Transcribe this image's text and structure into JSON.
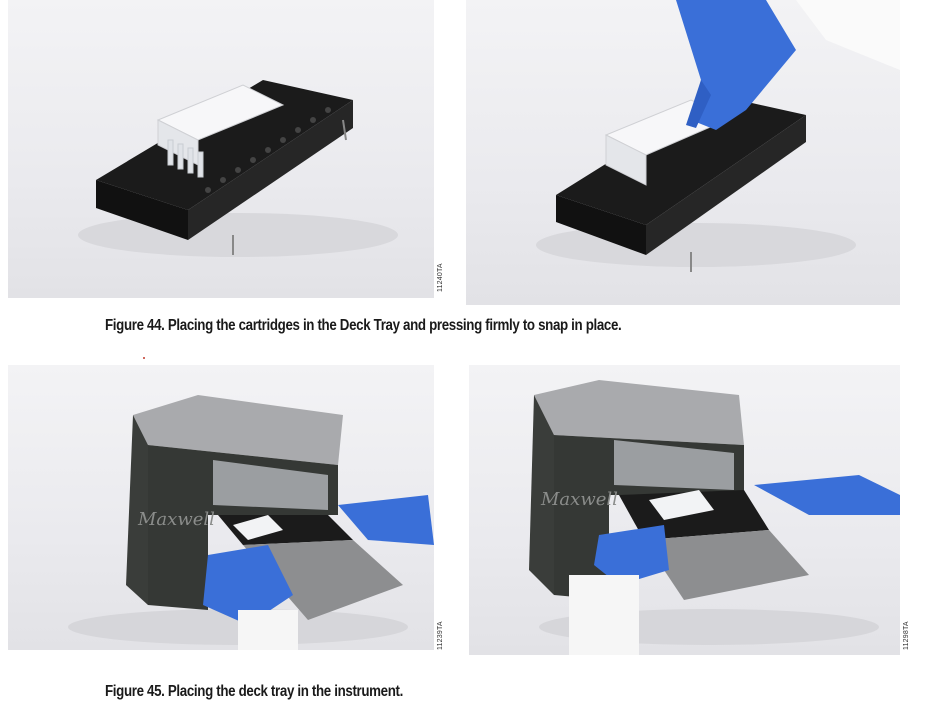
{
  "figure44": {
    "caption": "Figure 44. Placing the cartridges in the Deck Tray and pressing firmly to snap in place.",
    "code": "11240TA",
    "left_image": "deck-tray-with-cartridges",
    "right_image": "gloved-hand-pressing-cartridges"
  },
  "figure45": {
    "caption": "Figure 45. Placing the deck tray in the instrument.",
    "code_left": "11239TA",
    "code_right": "11298TA",
    "left_image": "inserting-deck-tray-left",
    "right_image": "inserting-deck-tray-right",
    "instrument_script": "Maxwell"
  },
  "colors": {
    "tray": "#1b1b1b",
    "glove": "#3a6fd8",
    "instrument_body": "#3a3d3a",
    "instrument_top": "#a9aaad"
  }
}
